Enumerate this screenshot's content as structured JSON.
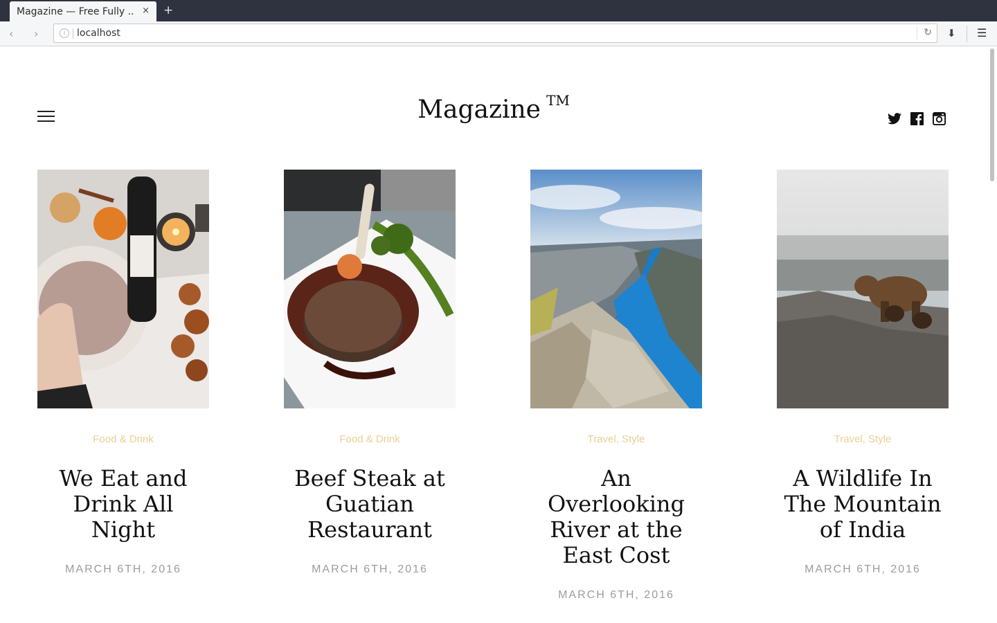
{
  "browser": {
    "tab_title": "Magazine — Free Fully ...",
    "tab_close": "×",
    "new_tab": "+",
    "url": "localhost",
    "back": "‹",
    "forward": "›",
    "reload": "↻",
    "download": "⬇",
    "menu": "☰",
    "info": "i"
  },
  "header": {
    "logo": "Magazine",
    "logo_mark": "TM"
  },
  "social": [
    "twitter-icon",
    "facebook-icon",
    "instagram-icon"
  ],
  "posts": [
    {
      "category": "Food & Drink",
      "title": "We Eat and Drink All Night",
      "date": "MARCH 6TH, 2016",
      "image": "food-flatlay-photo"
    },
    {
      "category": "Food & Drink",
      "title": "Beef Steak at Guatian Restaurant",
      "date": "MARCH 6TH, 2016",
      "image": "steak-plate-photo"
    },
    {
      "category": "Travel, Style",
      "title": "An Overlooking River at the East Cost",
      "date": "MARCH 6TH, 2016",
      "image": "fjord-cliff-photo"
    },
    {
      "category": "Travel, Style",
      "title": "A Wildlife In The Mountain of India",
      "date": "MARCH 6TH, 2016",
      "image": "bear-mountain-photo"
    }
  ],
  "colors": {
    "category": "#e8cf94",
    "date": "#9c9c9c",
    "title": "#111111",
    "chrome_dark": "#2f3340"
  }
}
